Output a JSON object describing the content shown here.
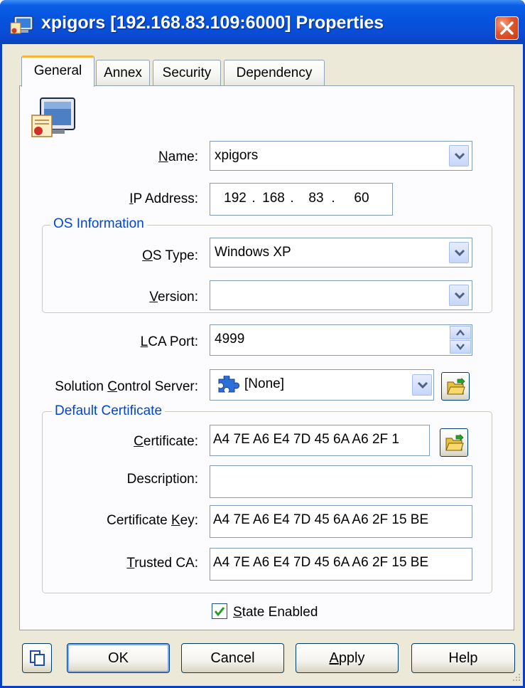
{
  "window": {
    "title": "xpigors [192.168.83.109:6000] Properties",
    "title_icon": "app-computer-icon",
    "close_icon": "close-x-icon"
  },
  "tabs": [
    {
      "label": "General",
      "active": true
    },
    {
      "label": "Annex",
      "active": false
    },
    {
      "label": "Security",
      "active": false
    },
    {
      "label": "Dependency",
      "active": false
    }
  ],
  "general": {
    "object_icon": "host-certificate-icon",
    "name": {
      "label_pre": "",
      "label_key": "N",
      "label_post": "ame:",
      "value": "xpigors"
    },
    "ip_address": {
      "label_pre": "",
      "label_key": "I",
      "label_post": "P Address:",
      "octets": [
        "192",
        "168",
        "83",
        "60"
      ],
      "separator": "."
    },
    "os_group": {
      "legend": "OS Information",
      "os_type": {
        "label_pre": "",
        "label_key": "O",
        "label_post": "S Type:",
        "value": "Windows XP"
      },
      "version": {
        "label_pre": "",
        "label_key": "V",
        "label_post": "ersion:",
        "value": ""
      }
    },
    "lca_port": {
      "label_pre": "",
      "label_key": "L",
      "label_post": "CA Port:",
      "value": "4999"
    },
    "scs": {
      "label_pre": "Solution ",
      "label_key": "C",
      "label_post": "ontrol Server:",
      "value": "[None]",
      "icon": "puzzle-piece-icon"
    },
    "cert_group": {
      "legend": "Default Certificate",
      "certificate": {
        "label_pre": "",
        "label_key": "C",
        "label_post": "ertificate:",
        "value": "A4 7E A6 E4 7D 45 6A A6 2F 1"
      },
      "description": {
        "label": "Description:",
        "value": ""
      },
      "certificate_key": {
        "label_pre": "Certificate ",
        "label_key": "K",
        "label_post": "ey:",
        "value": "A4 7E A6 E4 7D 45 6A A6 2F 15 BE"
      },
      "trusted_ca": {
        "label_pre": "",
        "label_key": "T",
        "label_post": "rusted CA:",
        "value": "A4 7E A6 E4 7D 45 6A A6 2F 15 BE"
      }
    },
    "state_enabled": {
      "label_key": "S",
      "label_post": "tate Enabled",
      "checked": true
    }
  },
  "buttons": {
    "copy_icon": "copy-pages-icon",
    "ok": "OK",
    "cancel": "Cancel",
    "apply_key": "A",
    "apply_post": "pply",
    "help": "Help"
  },
  "colors": {
    "titlebar": "#0553de",
    "dialog_bg": "#ece9d8",
    "group_legend": "#0046d5",
    "close_button": "#e2562e",
    "active_tab_accent": "#f5b43a"
  }
}
